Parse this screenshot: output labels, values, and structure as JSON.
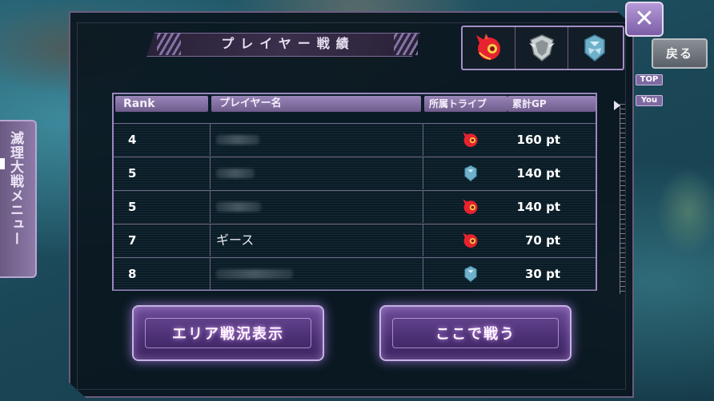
{
  "side_menu": {
    "label": "滅理大戦メニュー"
  },
  "title": "プレイヤー戦績",
  "controls": {
    "close_label": "✕",
    "back_label": "戻る"
  },
  "tribe_filter": [
    {
      "name": "fire-dragon-tribe",
      "color": "#e8222e"
    },
    {
      "name": "crest-tribe",
      "color": "#9aa7a8"
    },
    {
      "name": "ice-crystal-tribe",
      "color": "#5fa3c0"
    }
  ],
  "scroll_tags": {
    "top": "TOP",
    "you": "You"
  },
  "table": {
    "headers": {
      "rank": "Rank",
      "name": "プレイヤー名",
      "tribe": "所属トライブ",
      "gp": "累計GP"
    },
    "rows": [
      {
        "rank": "4",
        "name": "",
        "tribe": "fire-dragon-tribe",
        "gp": "160 pt"
      },
      {
        "rank": "5",
        "name": "",
        "tribe": "ice-crystal-tribe",
        "gp": "140 pt"
      },
      {
        "rank": "5",
        "name": "",
        "tribe": "fire-dragon-tribe",
        "gp": "140 pt"
      },
      {
        "rank": "7",
        "name": "ギース",
        "tribe": "fire-dragon-tribe",
        "gp": "70 pt"
      },
      {
        "rank": "8",
        "name": "",
        "tribe": "ice-crystal-tribe",
        "gp": "30 pt"
      }
    ]
  },
  "buttons": {
    "area": "エリア戦況表示",
    "fight": "ここで戦う"
  }
}
